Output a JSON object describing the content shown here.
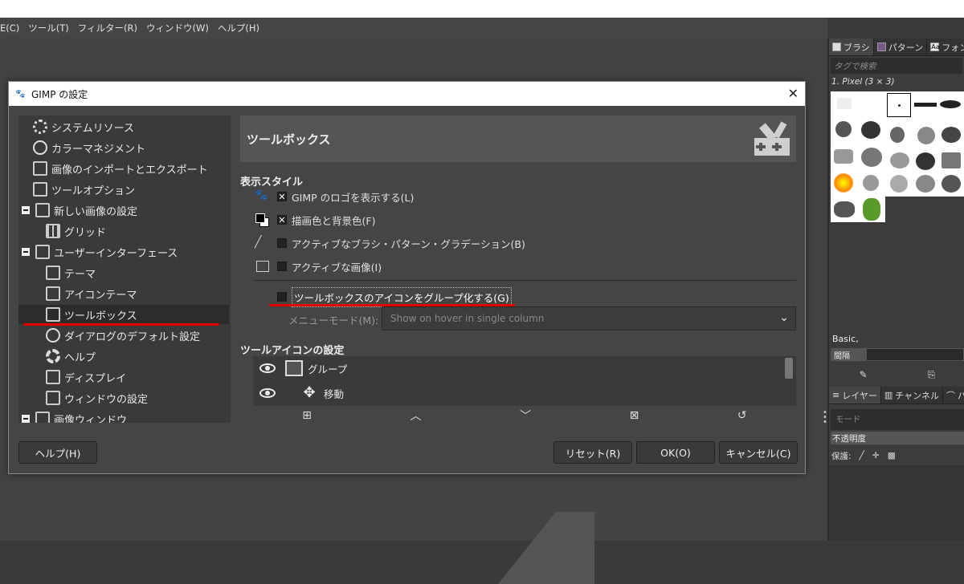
{
  "menubar": {
    "items": [
      "E(C)",
      "ツール(T)",
      "フィルター(R)",
      "ウィンドウ(W)",
      "ヘルプ(H)"
    ]
  },
  "right_panel": {
    "tabs": [
      {
        "label": "ブラシ",
        "icon": "brush-icon"
      },
      {
        "label": "パターン",
        "icon": "pattern-icon"
      },
      {
        "label": "フォン",
        "icon": "font-icon"
      }
    ],
    "tag_search_placeholder": "タグで検索",
    "brush_name": "1. Pixel (3 × 3)",
    "preset_name": "Basic,",
    "spacing_label": "間隔",
    "layer_tabs": [
      {
        "label": "レイヤー",
        "icon": "layers-icon"
      },
      {
        "label": "チャンネル",
        "icon": "channels-icon"
      },
      {
        "label": "パス",
        "icon": "paths-icon"
      }
    ],
    "mode_placeholder": "モード",
    "opacity_label": "不透明度",
    "protect_label": "保護:"
  },
  "dialog": {
    "title": "GIMP の設定",
    "tree": [
      {
        "label": "システムリソース",
        "icon": "chip-icon",
        "level": 1
      },
      {
        "label": "カラーマネジメント",
        "icon": "color-management-icon",
        "level": 1
      },
      {
        "label": "画像のインポートとエクスポート",
        "icon": "import-export-icon",
        "level": 1
      },
      {
        "label": "ツールオプション",
        "icon": "tool-options-icon",
        "level": 1
      },
      {
        "label": "新しい画像の設定",
        "icon": "new-image-icon",
        "level": 0
      },
      {
        "label": "グリッド",
        "icon": "grid-icon",
        "level": 2
      },
      {
        "label": "ユーザーインターフェース",
        "icon": "user-interface-icon",
        "level": 0
      },
      {
        "label": "テーマ",
        "icon": "theme-icon",
        "level": 2
      },
      {
        "label": "アイコンテーマ",
        "icon": "icon-theme-icon",
        "level": 2
      },
      {
        "label": "ツールボックス",
        "icon": "toolbox-icon",
        "level": 2,
        "selected": true
      },
      {
        "label": "ダイアログのデフォルト設定",
        "icon": "dialog-defaults-icon",
        "level": 2
      },
      {
        "label": "ヘルプ",
        "icon": "help-icon",
        "level": 2
      },
      {
        "label": "ディスプレイ",
        "icon": "display-icon",
        "level": 2
      },
      {
        "label": "ウィンドウの設定",
        "icon": "window-management-icon",
        "level": 2
      },
      {
        "label": "画像ウィンドウ",
        "icon": "image-window-icon",
        "level": 0
      }
    ],
    "header_title": "ツールボックス",
    "section_display_style": "表示スタイル",
    "checkboxes": [
      {
        "label": "GIMP のロゴを表示する(L)",
        "checked": true,
        "icon": "wilber-icon"
      },
      {
        "label": "描画色と背景色(F)",
        "checked": true,
        "icon": "fg-bg-color-icon"
      },
      {
        "label": "アクティブなブラシ・パターン・グラデーション(B)",
        "checked": false,
        "icon": "brush-pattern-icon"
      },
      {
        "label": "アクティブな画像(I)",
        "checked": false,
        "icon": "active-image-icon"
      }
    ],
    "group_checkbox": {
      "label": "ツールボックスのアイコンをグループ化する(G)",
      "checked": false
    },
    "menu_mode_label": "メニューモード(M):",
    "menu_mode_value": "Show on hover in single column",
    "section_tool_icons": "ツールアイコンの設定",
    "tool_icon_rows": [
      {
        "label": "グループ",
        "icon": "folder-icon"
      },
      {
        "label": "移動",
        "icon": "move-icon"
      }
    ],
    "list_buttons": [
      "new-group-icon",
      "move-up-icon",
      "move-down-icon",
      "delete-icon",
      "reset-icon"
    ],
    "buttons": {
      "help": "ヘルプ(H)",
      "reset": "リセット(R)",
      "ok": "OK(O)",
      "cancel": "キャンセル(C)"
    }
  },
  "annotation_color": "#e00000"
}
